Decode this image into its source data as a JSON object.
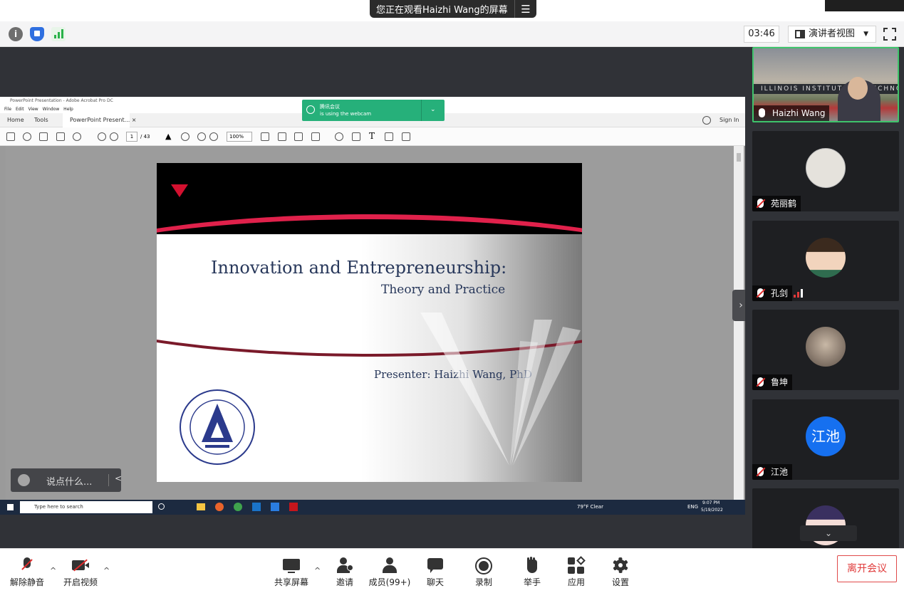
{
  "banner": {
    "viewing_text": "您正在观看Haizhi Wang的屏幕",
    "menu_glyph": "☰"
  },
  "toolbar": {
    "info_glyph": "i",
    "timer": "03:46",
    "layout_label": "演讲者视图",
    "layout_chevron": "▼"
  },
  "acrobat": {
    "window_title": "PowerPoint Presentation - Adobe Acrobat Pro DC",
    "menu": "File Edit View Window Help",
    "tab_home": "Home",
    "tab_tools": "Tools",
    "tab_document": "PowerPoint Present...  ×",
    "sign_in": "Sign In",
    "page_current": "1",
    "page_total": "/ 43",
    "zoom": "100%",
    "toast_title": "腾讯会议",
    "toast_body": "is using the webcam"
  },
  "slide": {
    "title": "Innovation and Entrepreneurship:",
    "subtitle": "Theory and Practice",
    "presenter": "Presenter: Haizhi Wang, PhD"
  },
  "chat": {
    "placeholder": "说点什么...",
    "arrow": "<"
  },
  "taskbar": {
    "search_placeholder": "Type here to search",
    "weather": "79°F  Clear",
    "lang": "ENG",
    "time": "9:07 PM",
    "date": "5/19/2022"
  },
  "participants": [
    {
      "name": "Haizhi Wang",
      "muted": false,
      "building_text": "ILLINOIS INSTITUTE OF TECHNOLOGY"
    },
    {
      "name": "苑丽鹤",
      "muted": true
    },
    {
      "name": "孔剑",
      "muted": true
    },
    {
      "name": "鲁坤",
      "muted": true
    },
    {
      "name": "江池",
      "muted": true,
      "avatar_text": "江池"
    },
    {
      "name": "",
      "muted": true
    }
  ],
  "panel": {
    "collapse_glyph": "›",
    "scroll_down_glyph": "⌄"
  },
  "controls": {
    "unmute": "解除静音",
    "start_video": "开启视频",
    "share_screen": "共享屏幕",
    "invite": "邀请",
    "members": "成员(99+)",
    "chat": "聊天",
    "record": "录制",
    "raise_hand": "举手",
    "apps": "应用",
    "settings": "设置",
    "leave": "离开会议",
    "caret": "^"
  },
  "colors": {
    "accent_green": "#3ec46b",
    "brand_blue": "#1670f0",
    "leave_red": "#e03a3a",
    "slide_red": "#e0214b",
    "slide_text": "#27375a"
  }
}
